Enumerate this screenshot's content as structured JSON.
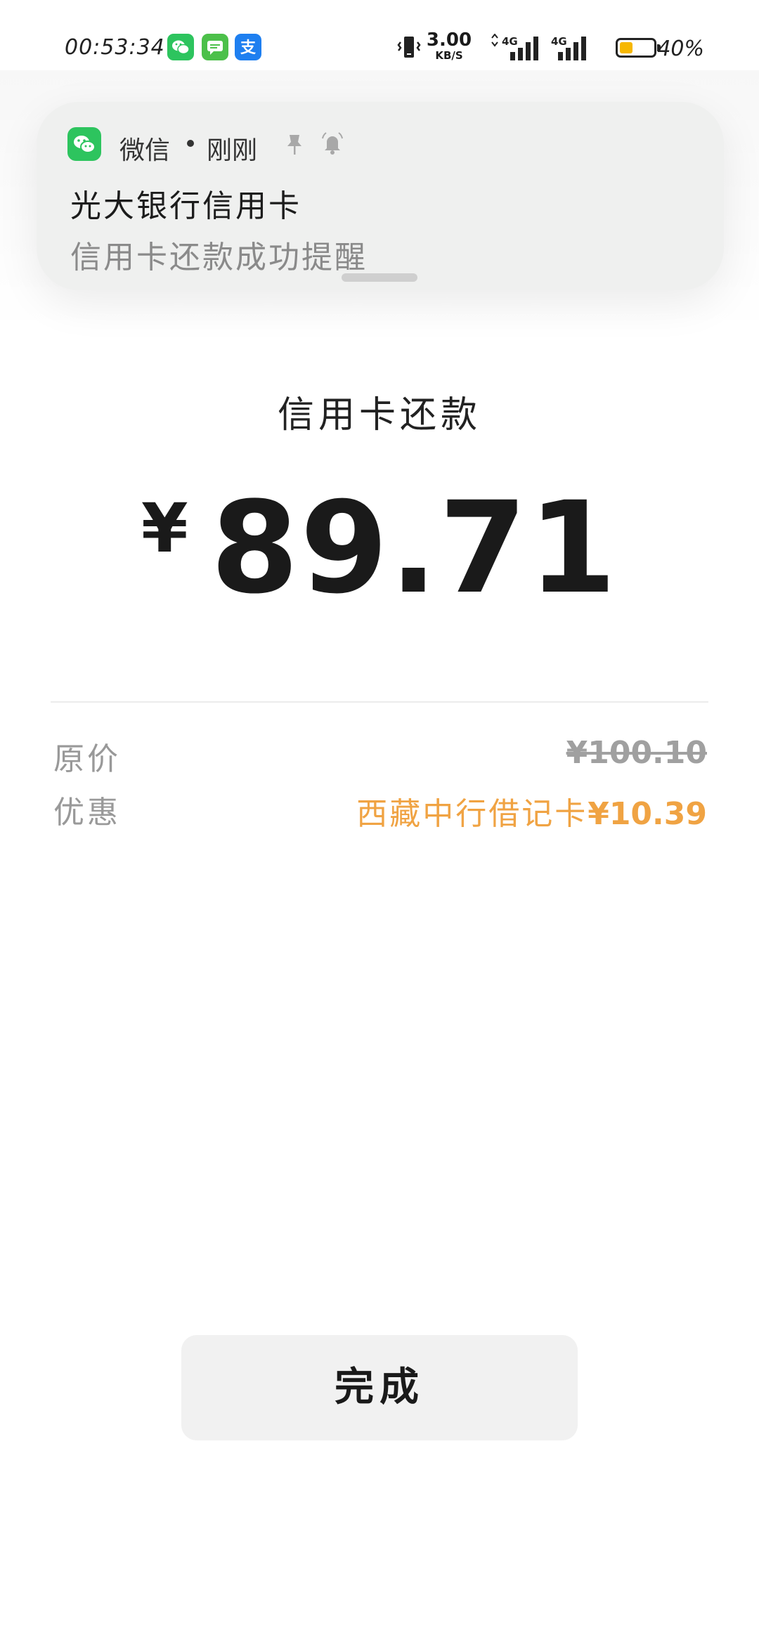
{
  "status_bar": {
    "time": "00:53:34",
    "app_icons": [
      "wechat-icon",
      "messages-icon",
      "alipay-icon"
    ],
    "network_speed_value": "3.00",
    "network_speed_unit": "KB/S",
    "signal1_label": "4G",
    "signal2_label": "4G",
    "battery_percent_text": "40%",
    "battery_level": 0.4,
    "battery_color": "#f6b700"
  },
  "notification": {
    "app_name": "微信",
    "time": "刚刚",
    "title": "光大银行信用卡",
    "body": "信用卡还款成功提醒",
    "icons": [
      "wechat-icon",
      "pin-icon",
      "bell-icon"
    ]
  },
  "payment": {
    "title": "信用卡还款",
    "currency": "¥",
    "amount": "89.71"
  },
  "details": {
    "original_label": "原价",
    "original_value": "¥100.10",
    "discount_label": "优惠",
    "discount_text": "西藏中行借记卡",
    "discount_amount": "¥10.39",
    "discount_color": "#f0a343"
  },
  "actions": {
    "done_label": "完成"
  }
}
